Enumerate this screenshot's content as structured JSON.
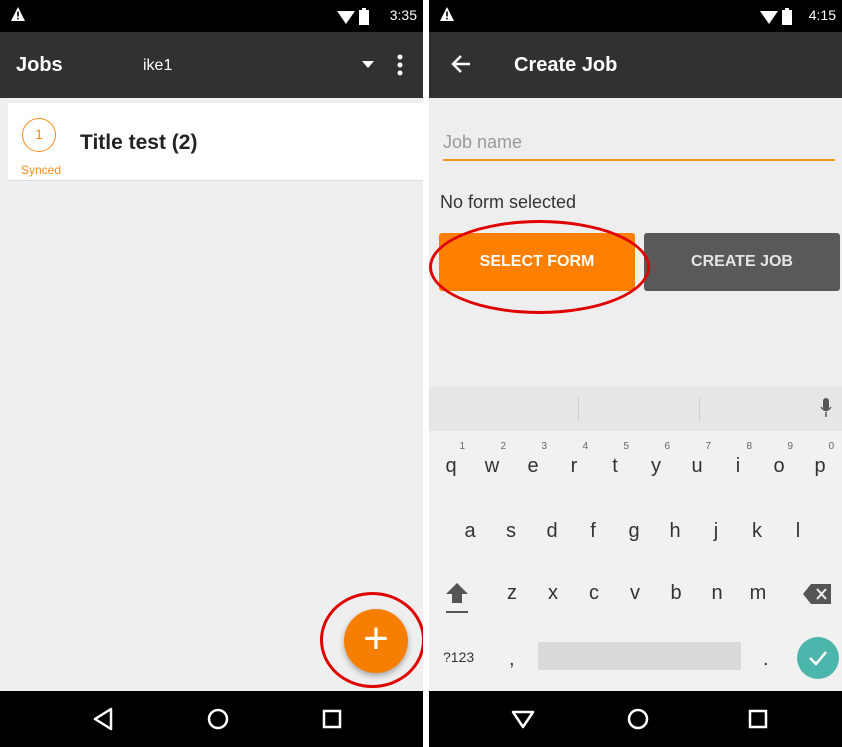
{
  "left": {
    "status": {
      "time": "3:35"
    },
    "appbar": {
      "title": "Jobs",
      "account": "ike1"
    },
    "jobs": [
      {
        "count": "1",
        "title": "Title test (2)",
        "status": "Synced"
      }
    ],
    "fab_icon": "+"
  },
  "right": {
    "status": {
      "time": "4:15"
    },
    "appbar": {
      "title": "Create Job"
    },
    "form": {
      "job_name_placeholder": "Job name",
      "job_name_value": "",
      "form_status": "No form selected",
      "select_form_label": "SELECT FORM",
      "create_job_label": "CREATE JOB"
    },
    "keyboard": {
      "row1": [
        {
          "key": "q",
          "hint": "1"
        },
        {
          "key": "w",
          "hint": "2"
        },
        {
          "key": "e",
          "hint": "3"
        },
        {
          "key": "r",
          "hint": "4"
        },
        {
          "key": "t",
          "hint": "5"
        },
        {
          "key": "y",
          "hint": "6"
        },
        {
          "key": "u",
          "hint": "7"
        },
        {
          "key": "i",
          "hint": "8"
        },
        {
          "key": "o",
          "hint": "9"
        },
        {
          "key": "p",
          "hint": "0"
        }
      ],
      "row2": [
        "a",
        "s",
        "d",
        "f",
        "g",
        "h",
        "j",
        "k",
        "l"
      ],
      "row3": [
        "z",
        "x",
        "c",
        "v",
        "b",
        "n",
        "m"
      ],
      "symbols_label": "?123",
      "comma": ",",
      "period": "."
    }
  },
  "colors": {
    "accent": "#ff7f00",
    "appbar": "#313131",
    "annotation": "#e00000",
    "enter_key": "#4db6ac"
  },
  "icons": [
    "warning-icon",
    "wifi-icon",
    "battery-icon",
    "dropdown-icon",
    "more-vert-icon",
    "back-arrow-icon",
    "microphone-icon",
    "shift-icon",
    "backspace-icon",
    "check-icon",
    "nav-back-icon",
    "nav-home-icon",
    "nav-recents-icon"
  ]
}
